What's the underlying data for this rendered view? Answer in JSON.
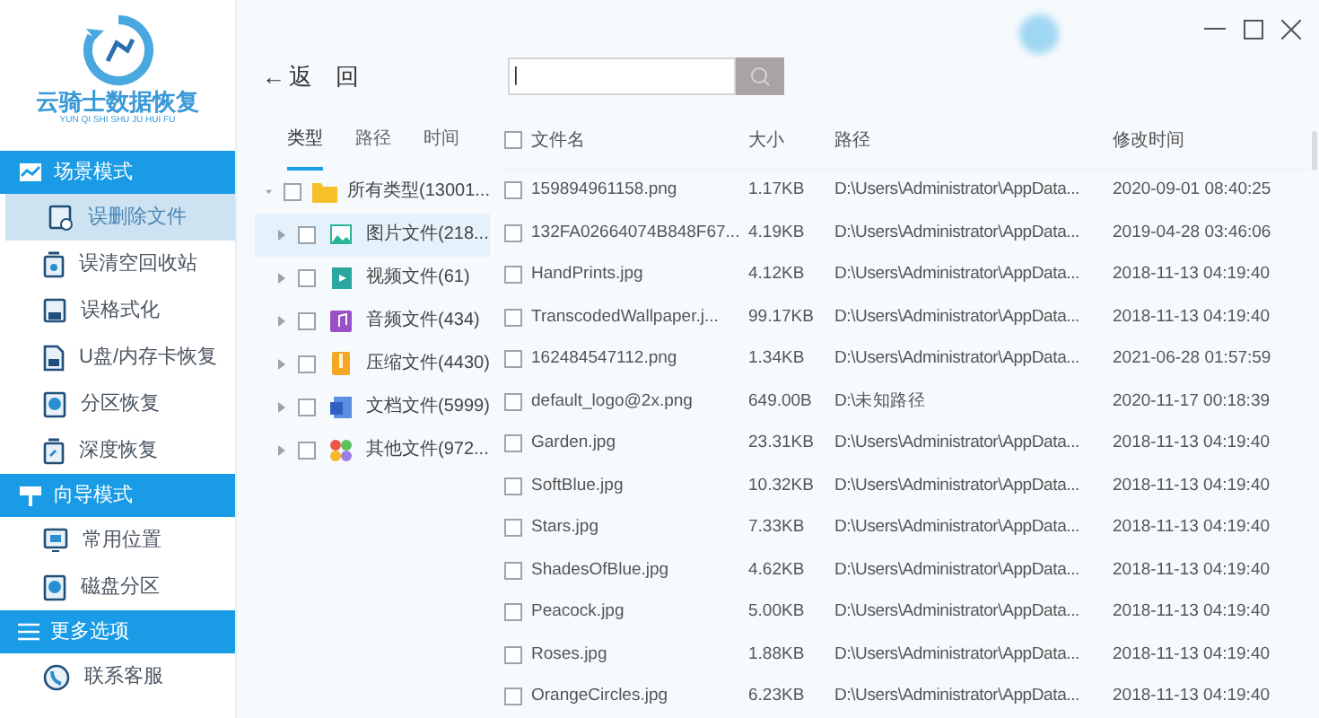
{
  "app": {
    "logo_title": "云骑士数据恢复",
    "logo_subtitle": "YUN QI SHI SHU JU HUI FU"
  },
  "sidebar": [
    {
      "title": "场景模式",
      "kind": "scene",
      "items": [
        {
          "label": "误删除文件",
          "selected": true
        },
        {
          "label": "误清空回收站",
          "selected": false
        },
        {
          "label": "误格式化",
          "selected": false
        },
        {
          "label": "U盘/内存卡恢复",
          "selected": false
        },
        {
          "label": "分区恢复",
          "selected": false
        },
        {
          "label": "深度恢复",
          "selected": false
        }
      ]
    },
    {
      "title": "向导模式",
      "kind": "guide",
      "items": [
        {
          "label": "常用位置",
          "selected": false
        },
        {
          "label": "磁盘分区",
          "selected": false
        }
      ]
    },
    {
      "title": "更多选项",
      "kind": "more",
      "items": [
        {
          "label": "联系客服",
          "selected": false
        }
      ]
    }
  ],
  "toolbar": {
    "back": "←",
    "back_label": "返　回"
  },
  "search": {
    "value": "|"
  },
  "tree_tabs": [
    {
      "label": "类型",
      "selected": true
    },
    {
      "label": "路径",
      "selected": false
    },
    {
      "label": "时间",
      "selected": false
    }
  ],
  "tree": [
    {
      "label": "所有类型(13001...",
      "kind": "folder",
      "checked": false,
      "expanded": true,
      "selected": false,
      "children": [
        {
          "label": "图片文件(218...",
          "kind": "image",
          "checked": false,
          "expanded": false,
          "selected": true
        },
        {
          "label": "视频文件(61)",
          "kind": "video",
          "checked": false,
          "expanded": false,
          "selected": false
        },
        {
          "label": "音频文件(434)",
          "kind": "audio",
          "checked": false,
          "expanded": false,
          "selected": false
        },
        {
          "label": "压缩文件(4430)",
          "kind": "archive",
          "checked": false,
          "expanded": false,
          "selected": false
        },
        {
          "label": "文档文件(5999)",
          "kind": "document",
          "checked": false,
          "expanded": false,
          "selected": false
        },
        {
          "label": "其他文件(972...",
          "kind": "other",
          "checked": false,
          "expanded": false,
          "selected": false
        }
      ]
    }
  ],
  "table": {
    "checked": false,
    "columns": [
      "文件名",
      "大小",
      "路径",
      "修改时间"
    ],
    "rows": [
      {
        "checked": false,
        "name": "159894961158.png",
        "size": "1.17KB",
        "path": "D:\\Users\\Administrator\\AppData...",
        "time": "2020-09-01 08:40:25"
      },
      {
        "checked": false,
        "name": "132FA02664074B848F67...",
        "size": "4.19KB",
        "path": "D:\\Users\\Administrator\\AppData...",
        "time": "2019-04-28 03:46:06"
      },
      {
        "checked": false,
        "name": "HandPrints.jpg",
        "size": "4.12KB",
        "path": "D:\\Users\\Administrator\\AppData...",
        "time": "2018-11-13 04:19:40"
      },
      {
        "checked": false,
        "name": "TranscodedWallpaper.j...",
        "size": "99.17KB",
        "path": "D:\\Users\\Administrator\\AppData...",
        "time": "2018-11-13 04:19:40"
      },
      {
        "checked": false,
        "name": "162484547112.png",
        "size": "1.34KB",
        "path": "D:\\Users\\Administrator\\AppData...",
        "time": "2021-06-28 01:57:59"
      },
      {
        "checked": false,
        "name": "default_logo@2x.png",
        "size": "649.00B",
        "path": "D:\\未知路径",
        "time": "2020-11-17 00:18:39"
      },
      {
        "checked": false,
        "name": "Garden.jpg",
        "size": "23.31KB",
        "path": "D:\\Users\\Administrator\\AppData...",
        "time": "2018-11-13 04:19:40"
      },
      {
        "checked": false,
        "name": "SoftBlue.jpg",
        "size": "10.32KB",
        "path": "D:\\Users\\Administrator\\AppData...",
        "time": "2018-11-13 04:19:40"
      },
      {
        "checked": false,
        "name": "Stars.jpg",
        "size": "7.33KB",
        "path": "D:\\Users\\Administrator\\AppData...",
        "time": "2018-11-13 04:19:40"
      },
      {
        "checked": false,
        "name": "ShadesOfBlue.jpg",
        "size": "4.62KB",
        "path": "D:\\Users\\Administrator\\AppData...",
        "time": "2018-11-13 04:19:40"
      },
      {
        "checked": false,
        "name": "Peacock.jpg",
        "size": "5.00KB",
        "path": "D:\\Users\\Administrator\\AppData...",
        "time": "2018-11-13 04:19:40"
      },
      {
        "checked": false,
        "name": "Roses.jpg",
        "size": "1.88KB",
        "path": "D:\\Users\\Administrator\\AppData...",
        "time": "2018-11-13 04:19:40"
      },
      {
        "checked": false,
        "name": "OrangeCircles.jpg",
        "size": "6.23KB",
        "path": "D:\\Users\\Administrator\\AppData...",
        "time": "2018-11-13 04:19:40"
      }
    ]
  }
}
